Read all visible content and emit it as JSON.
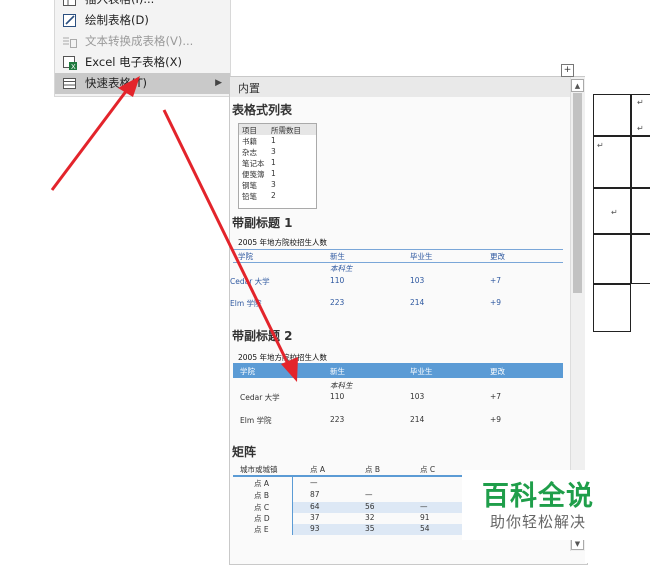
{
  "menu": {
    "items": [
      {
        "label": "插入表格(I)...",
        "disabled": false
      },
      {
        "label": "绘制表格(D)",
        "disabled": false
      },
      {
        "label": "文本转换成表格(V)...",
        "disabled": true
      },
      {
        "label": "Excel 电子表格(X)",
        "disabled": false
      },
      {
        "label": "快速表格(T)",
        "disabled": false,
        "highlighted": true
      }
    ]
  },
  "gallery": {
    "header": "内置",
    "section1": {
      "title": "表格式列表",
      "columns": [
        "项目",
        "所需数目"
      ],
      "rows": [
        [
          "书籍",
          "1"
        ],
        [
          "杂志",
          "3"
        ],
        [
          "笔记本",
          "1"
        ],
        [
          "便笺簿",
          "1"
        ],
        [
          "钢笔",
          "3"
        ],
        [
          "铅笔",
          "2"
        ]
      ]
    },
    "section2": {
      "title": "带副标题 1",
      "caption": "2005 年地方院校招生人数",
      "columns": [
        "学院",
        "新生",
        "毕业生",
        "更改"
      ],
      "subheader": "本科生",
      "rows": [
        [
          "Cedar 大学",
          "110",
          "103",
          "+7"
        ],
        [
          "Elm 学院",
          "223",
          "214",
          "+9"
        ]
      ]
    },
    "section3": {
      "title": "带副标题 2",
      "caption": "2005 年地方院校招生人数",
      "columns": [
        "学院",
        "新生",
        "毕业生",
        "更改"
      ],
      "subheader": "本科生",
      "rows": [
        [
          "Cedar 大学",
          "110",
          "103",
          "+7"
        ],
        [
          "Elm 学院",
          "223",
          "214",
          "+9"
        ]
      ]
    },
    "section4": {
      "title": "矩阵",
      "columns": [
        "城市或城镇",
        "点 A",
        "点 B",
        "点 C"
      ],
      "rows": [
        [
          "点 A",
          "—",
          "",
          ""
        ],
        [
          "点 B",
          "87",
          "—",
          ""
        ],
        [
          "点 C",
          "64",
          "56",
          "—"
        ],
        [
          "点 D",
          "37",
          "32",
          "91"
        ],
        [
          "点 E",
          "93",
          "35",
          "54"
        ]
      ]
    }
  },
  "scroll_up": "▲",
  "scroll_down": "▼",
  "submenu_arrow": "▶",
  "doc": {
    "return_mark": "↵",
    "move_handle": "+"
  },
  "watermark": {
    "title": "百科全说",
    "subtitle": "助你轻松解决"
  },
  "colors": {
    "accent_blue": "#5b9bd5",
    "text_blue": "#2e58a0",
    "arrow_red": "#e3242b",
    "watermark_green": "#1f9e4a"
  },
  "icons": [
    "insert-table-icon",
    "draw-table-icon",
    "text-to-table-icon",
    "excel-icon",
    "quick-table-icon"
  ]
}
